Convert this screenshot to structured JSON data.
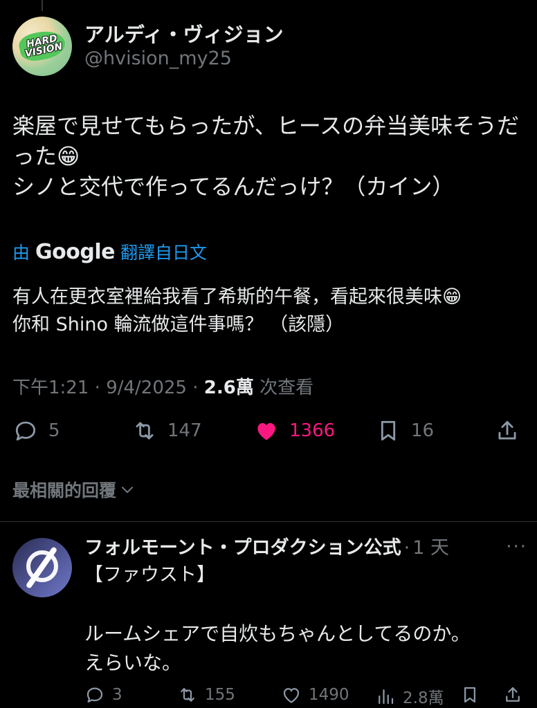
{
  "tweet": {
    "author": {
      "display_name": "アルディ・ヴィジョン",
      "handle": "@hvision_my25",
      "avatar_text": "HARD VISION"
    },
    "text": "楽屋で見せてもらったが、ヒースの弁当美味そうだった😁\nシノと交代で作ってるんだっけ？（カイン）",
    "translation": {
      "prefix": "由",
      "provider": "Google",
      "suffix": "翻譯自日文",
      "text": "有人在更衣室裡給我看了希斯的午餐，看起來很美味😁\n你和 Shino 輪流做這件事嗎？ （該隱）"
    },
    "meta": {
      "time": "下午1:21",
      "date": "9/4/2025",
      "separator": "·",
      "views": "2.6萬",
      "views_label": "次查看"
    },
    "actions": {
      "replies": "5",
      "reposts": "147",
      "likes": "1366",
      "bookmarks": "16",
      "liked": true,
      "like_color": "#f91880"
    }
  },
  "sort": {
    "label": "最相關的回覆"
  },
  "reply": {
    "display_name": "フォルモーント・プロダクション公式",
    "time": "1 天",
    "separator": "·",
    "more": "···",
    "tag": "【ファウスト】",
    "text": "ルームシェアで自炊もちゃんとしてるのか。\nえらいな。",
    "actions": {
      "replies": "3",
      "reposts": "155",
      "likes": "1490",
      "views": "2.8萬"
    }
  },
  "icons": [
    "reply-icon",
    "repost-icon",
    "heart-icon",
    "bookmark-icon",
    "share-icon",
    "views-icon",
    "chevron-down-icon"
  ]
}
